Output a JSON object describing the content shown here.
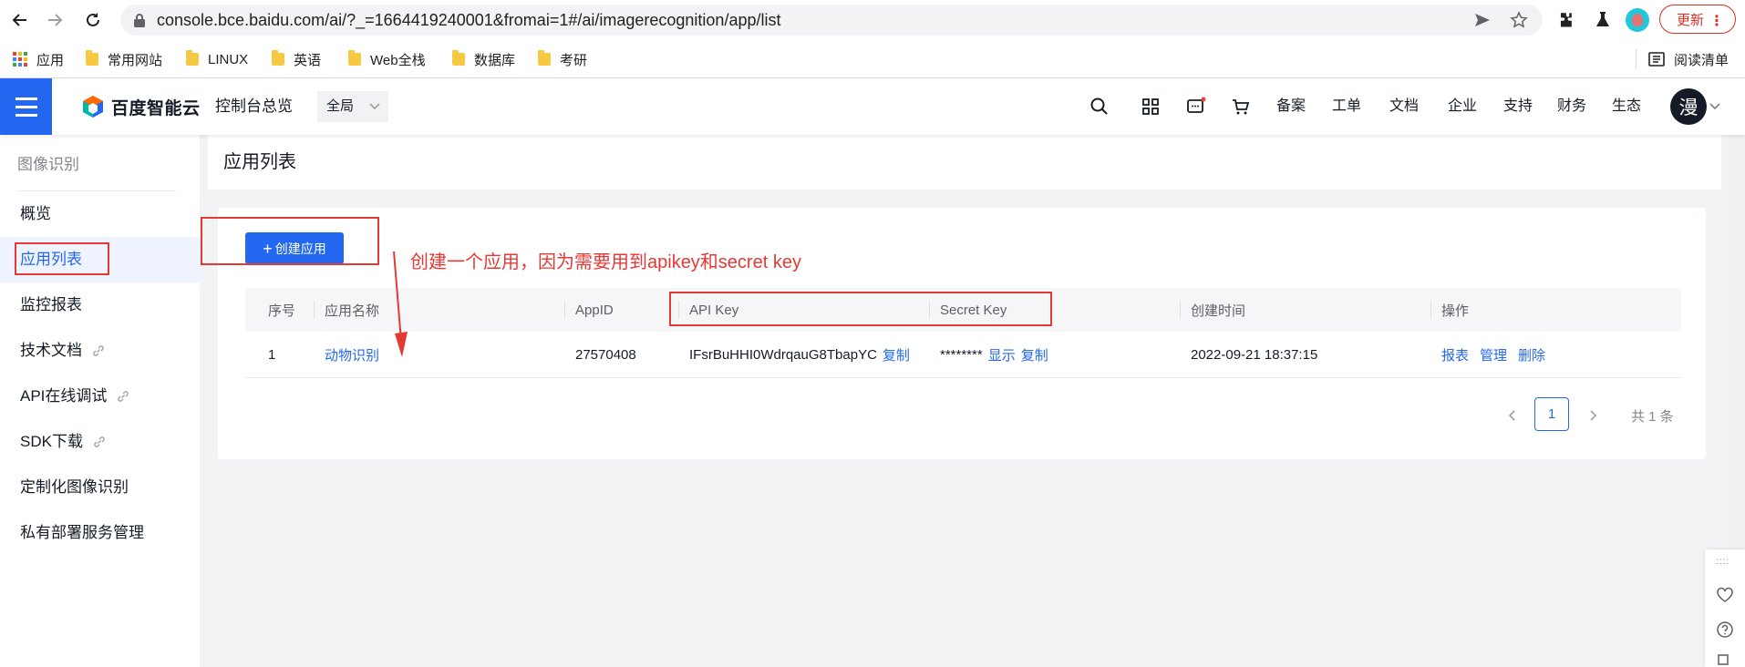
{
  "browser": {
    "url": "console.bce.baidu.com/ai/?_=1664419240001&fromai=1#/ai/imagerecognition/app/list",
    "update_label": "更新",
    "reading_list": "阅读清单",
    "bookmarks": [
      {
        "label": "应用",
        "icon": "apps-grid-icon"
      },
      {
        "label": "常用网站",
        "icon": "folder-icon"
      },
      {
        "label": "LINUX",
        "icon": "folder-icon"
      },
      {
        "label": "英语",
        "icon": "folder-icon"
      },
      {
        "label": "Web全栈",
        "icon": "folder-icon"
      },
      {
        "label": "数据库",
        "icon": "folder-icon"
      },
      {
        "label": "考研",
        "icon": "folder-icon"
      }
    ]
  },
  "header": {
    "logo": "百度智能云",
    "console_home": "控制台总览",
    "region": "全局",
    "links": [
      "备案",
      "工单",
      "文档",
      "企业",
      "支持",
      "财务",
      "生态"
    ],
    "avatar": "漫"
  },
  "sidebar": {
    "title": "图像识别",
    "items": [
      {
        "label": "概览",
        "link": false
      },
      {
        "label": "应用列表",
        "link": false,
        "active": true
      },
      {
        "label": "监控报表",
        "link": false
      },
      {
        "label": "技术文档",
        "link": true
      },
      {
        "label": "API在线调试",
        "link": true
      },
      {
        "label": "SDK下载",
        "link": true
      },
      {
        "label": "定制化图像识别",
        "link": false
      },
      {
        "label": "私有部署服务管理",
        "link": false
      }
    ]
  },
  "main": {
    "page_title": "应用列表",
    "create_button": "创建应用",
    "annotation": "创建一个应用，因为需要用到apikey和secret key",
    "table": {
      "headers": [
        "序号",
        "应用名称",
        "AppID",
        "API Key",
        "Secret Key",
        "创建时间",
        "操作"
      ],
      "rows": [
        {
          "index": "1",
          "name": "动物识别",
          "app_id": "27570408",
          "api_key": "IFsrBuHHI0WdrqauG8TbapYC",
          "api_copy": "复制",
          "secret_mask": "********",
          "secret_show": "显示",
          "secret_copy": "复制",
          "created": "2022-09-21 18:37:15",
          "actions": [
            "报表",
            "管理",
            "删除"
          ]
        }
      ]
    },
    "pagination": {
      "current": "1",
      "total": "共 1 条"
    }
  },
  "colors": {
    "primary": "#2468f2",
    "annotation": "#e53935",
    "update": "#d93025"
  }
}
